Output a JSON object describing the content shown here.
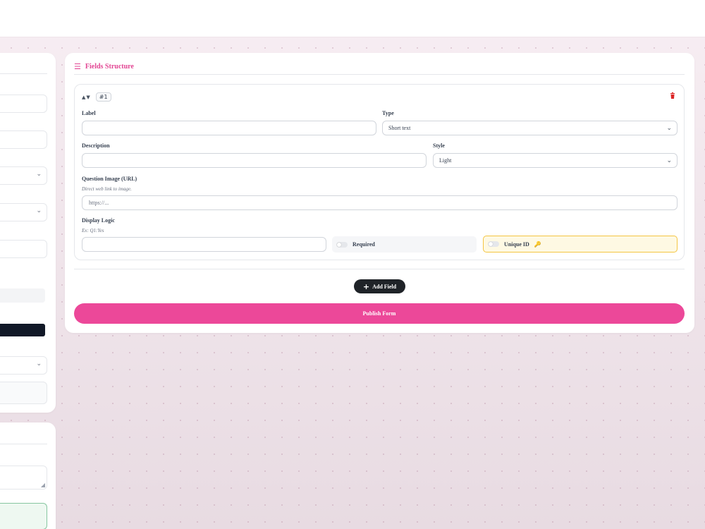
{
  "section": {
    "icon": "list-icon",
    "title": "Fields Structure"
  },
  "field": {
    "index_badge": "#1",
    "label_label": "Label",
    "label_value": "",
    "type_label": "Type",
    "type_value": "Short text",
    "description_label": "Description",
    "description_value": "",
    "style_label": "Style",
    "style_value": "Light",
    "image_label": "Question Image (URL)",
    "image_hint": "Direct web link to image.",
    "image_placeholder": "https://...",
    "logic_label": "Display Logic",
    "logic_hint": "Ex: Q1:Yes",
    "logic_value": "",
    "required_label": "Required",
    "required_on": false,
    "unique_label": "Unique ID",
    "unique_on": false
  },
  "actions": {
    "add_field": "Add Field",
    "publish": "Publish Form"
  },
  "colors": {
    "accent": "#ec4899",
    "title": "#e24593",
    "dark_button": "#1f2328",
    "danger": "#dc2626",
    "unique_bg": "#fef9e3",
    "unique_border": "#f4c542"
  }
}
